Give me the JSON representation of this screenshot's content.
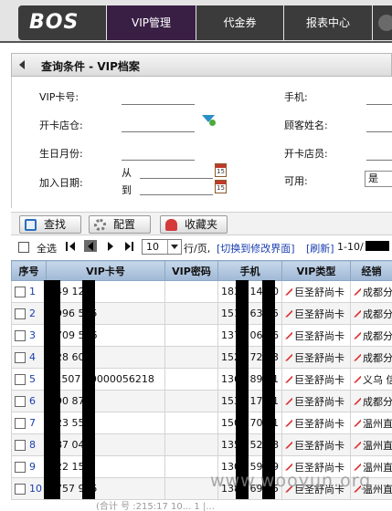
{
  "nav": {
    "logo": "BOS",
    "tabs": [
      {
        "label": "VIP管理",
        "active": true
      },
      {
        "label": "代金券",
        "active": false
      },
      {
        "label": "报表中心",
        "active": false
      }
    ]
  },
  "query": {
    "title": "查询条件 - VIP档案",
    "vip_card_label": "VIP卡号:",
    "store_label": "开卡店仓:",
    "birth_label": "生日月份:",
    "join_label": "加入日期:",
    "from_label": "从",
    "to_label": "到",
    "phone_label": "手机:",
    "name_label": "顾客姓名:",
    "staff_label": "开卡店员:",
    "available_label": "可用:",
    "available_value": "是"
  },
  "toolbar": {
    "search": "查找",
    "config": "配置",
    "favorites": "收藏夹"
  },
  "pager": {
    "select_all": "全选",
    "page_size": "10",
    "per_page": "行/页,",
    "switch_link": "[切换到修改界面]",
    "refresh_link": "[刷新]",
    "range": "1-10/"
  },
  "table": {
    "headers": [
      "序号",
      "VIP卡号",
      "VIP密码",
      "手机",
      "VIP类型",
      "经销"
    ],
    "rows": [
      {
        "n": "1",
        "card": "349 120",
        "pwd": "",
        "phone": "1834 149 0",
        "type": "巨圣舒尚卡",
        "dealer": "成都分"
      },
      {
        "n": "2",
        "card": "1996 545",
        "pwd": "",
        "phone": "1519 635 5",
        "type": "巨圣舒尚卡",
        "dealer": "成都分"
      },
      {
        "n": "3",
        "card": "1709 546",
        "pwd": "",
        "phone": "1370 069 6",
        "type": "巨圣舒尚卡",
        "dealer": "成都分"
      },
      {
        "n": "4",
        "card": "228 603",
        "pwd": "",
        "phone": "1522 720 3",
        "type": "巨圣舒尚卡",
        "dealer": "成都分"
      },
      {
        "n": "5",
        "card": "k1507 00000056218",
        "pwd": "",
        "phone": "1362 898 1",
        "type": "巨圣舒尚卡",
        "dealer": "义乌 信"
      },
      {
        "n": "6",
        "card": "390 871",
        "pwd": "",
        "phone": "1539 174 1",
        "type": "巨圣舒尚卡",
        "dealer": "成都分"
      },
      {
        "n": "7",
        "card": "023 551",
        "pwd": "",
        "phone": "1502 707 1",
        "type": "巨圣舒尚卡",
        "dealer": "温州直"
      },
      {
        "n": "8",
        "card": "587 048",
        "pwd": "",
        "phone": "1358 522 8",
        "type": "巨圣舒尚卡",
        "dealer": "温州直"
      },
      {
        "n": "9",
        "card": "022 159",
        "pwd": "",
        "phone": "1302 597 9",
        "type": "巨圣舒尚卡",
        "dealer": "温州直"
      },
      {
        "n": "10",
        "card": "0757 975",
        "pwd": "",
        "phone": "1380 693 5",
        "type": "巨圣舒尚卡",
        "dealer": "温州直"
      }
    ]
  },
  "footer": {
    "text": "(合计 号 :215:17 10... 1 |...",
    "watermark": "www.wooyun.org"
  }
}
